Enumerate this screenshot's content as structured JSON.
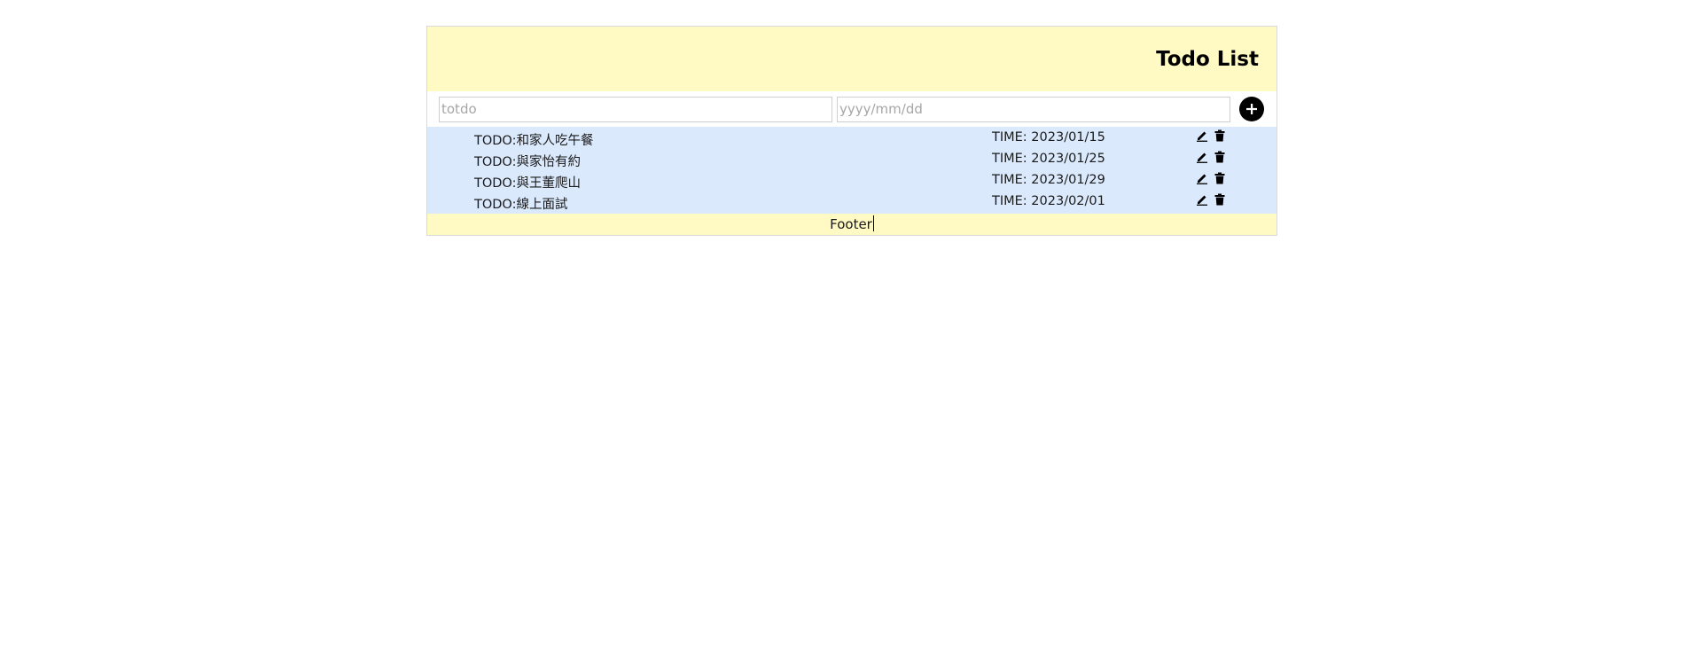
{
  "header": {
    "title": "Todo List"
  },
  "form": {
    "todo_placeholder": "totdo",
    "todo_value": "",
    "date_placeholder": "yyyy/mm/dd",
    "date_value": "",
    "add_icon": "plus-circle-icon"
  },
  "todos": [
    {
      "todo": "TODO:和家人吃午餐",
      "time": "TIME: 2023/01/15"
    },
    {
      "todo": "TODO:與家怡有約",
      "time": "TIME: 2023/01/25"
    },
    {
      "todo": "TODO:與王董爬山",
      "time": "TIME: 2023/01/29"
    },
    {
      "todo": "TODO:線上面試",
      "time": "TIME: 2023/02/01"
    }
  ],
  "actions": {
    "edit_icon": "pencil-icon",
    "delete_icon": "trash-icon"
  },
  "footer": {
    "text": "Footer"
  },
  "colors": {
    "header_bg": "#fff9c4",
    "list_bg": "#dbe9fd",
    "footer_bg": "#fff9c4",
    "accent": "#000000"
  }
}
